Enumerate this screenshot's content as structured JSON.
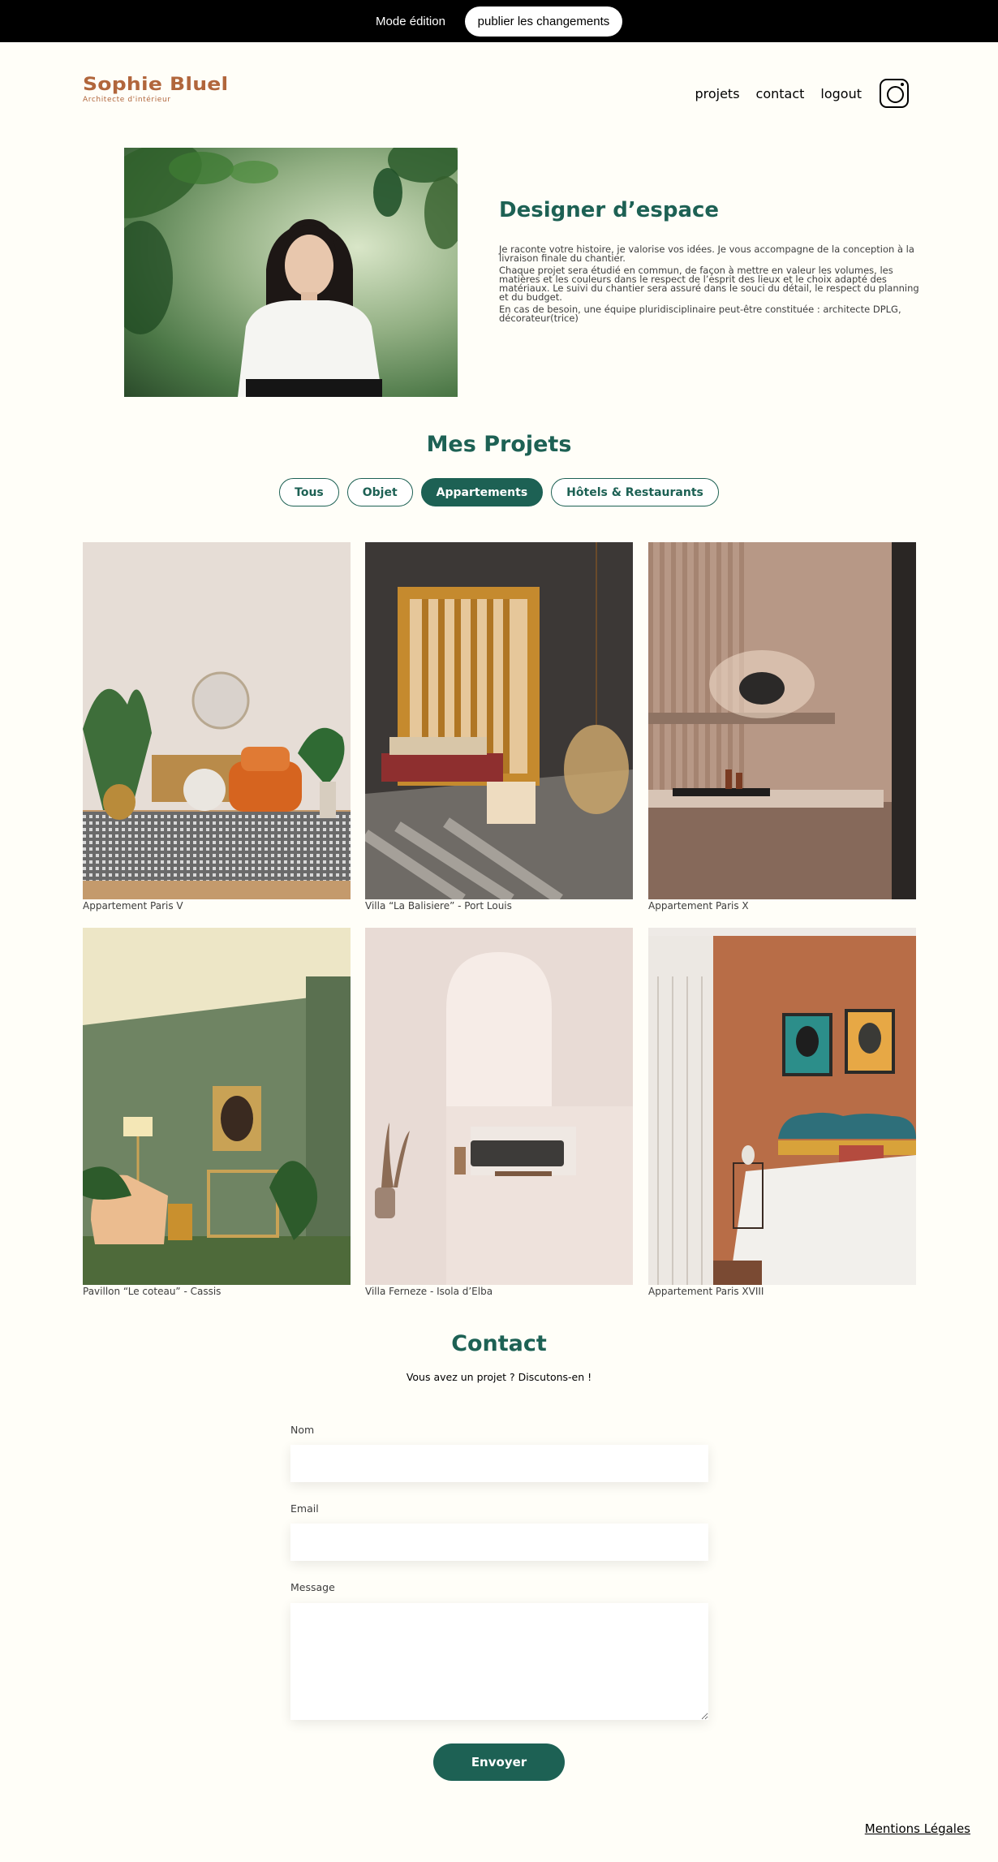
{
  "edit_bar": {
    "mode_label": "Mode édition",
    "publish_label": "publier les changements"
  },
  "header": {
    "logo_title": "Sophie Bluel",
    "logo_subtitle": "Architecte d'intérieur",
    "nav": [
      "projets",
      "contact",
      "logout"
    ],
    "instagram_icon": "instagram-icon"
  },
  "intro": {
    "title": "Designer d’espace",
    "paragraphs": [
      "Je raconte votre histoire, je valorise vos idées. Je vous accompagne de la conception à la livraison finale du chantier.",
      "Chaque projet sera étudié en commun, de façon à mettre en valeur les volumes, les matières et les couleurs dans le respect de l’esprit des lieux et le choix adapté des matériaux. Le suivi du chantier sera assuré dans le souci du détail, le respect du planning et du budget.",
      "En cas de besoin, une équipe pluridisciplinaire peut-être constituée : architecte DPLG, décorateur(trice)"
    ]
  },
  "projects": {
    "title": "Mes Projets",
    "filters": [
      "Tous",
      "Objet",
      "Appartements",
      "Hôtels & Restaurants"
    ],
    "active_filter": "Appartements",
    "items": [
      "Appartement Paris V",
      "Villa “La Balisiere” - Port Louis",
      "Appartement Paris X",
      "Pavillon “Le coteau” - Cassis",
      "Villa Ferneze - Isola d’Elba",
      "Appartement Paris XVIII"
    ]
  },
  "contact": {
    "title": "Contact",
    "subtitle": "Vous avez un projet ? Discutons-en !",
    "name_label": "Nom",
    "email_label": "Email",
    "message_label": "Message",
    "name_value": "",
    "email_value": "",
    "message_value": "",
    "submit_label": "Envoyer"
  },
  "footer": {
    "legal": "Mentions Légales"
  },
  "colors": {
    "brand_green": "#1D6154",
    "logo_brown": "#B1663C",
    "background": "#FFFEF8"
  }
}
